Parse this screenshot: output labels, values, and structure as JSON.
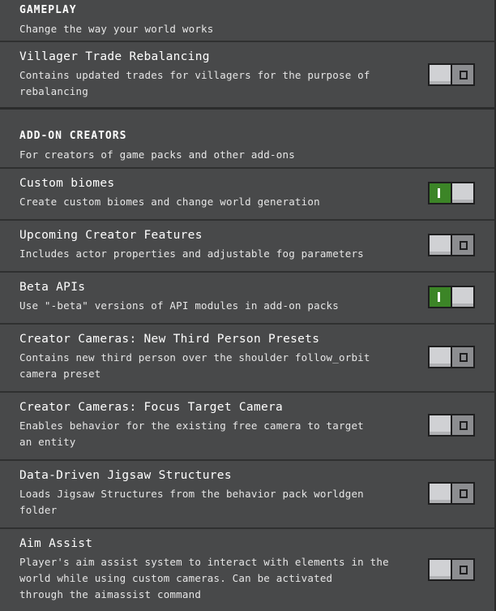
{
  "sections": {
    "gameplay": {
      "title": "GAMEPLAY",
      "description": "Change the way your world works"
    },
    "addon": {
      "title": "ADD-ON CREATORS",
      "description": "For creators of game packs and other add-ons"
    }
  },
  "settings": [
    {
      "title": "Villager Trade Rebalancing",
      "desc_lines": [
        "Contains updated trades for villagers for the purpose of",
        "rebalancing"
      ],
      "enabled": false
    },
    {
      "title": "Custom biomes",
      "desc_lines": [
        "Create custom biomes and change world generation"
      ],
      "enabled": true
    },
    {
      "title": "Upcoming Creator Features",
      "desc_lines": [
        "Includes actor properties and adjustable fog parameters"
      ],
      "enabled": false
    },
    {
      "title": "Beta APIs",
      "desc_lines": [
        "Use \"-beta\" versions of API modules in add-on packs"
      ],
      "enabled": true
    },
    {
      "title": "Creator Cameras: New Third Person Presets",
      "desc_lines": [
        "Contains new third person over the shoulder follow_orbit",
        "camera preset"
      ],
      "enabled": false
    },
    {
      "title": "Creator Cameras: Focus Target Camera",
      "desc_lines": [
        "Enables behavior for the existing free camera to target",
        "an entity"
      ],
      "enabled": false
    },
    {
      "title": "Data-Driven Jigsaw Structures",
      "desc_lines": [
        "Loads Jigsaw Structures from the behavior pack worldgen",
        "folder"
      ],
      "enabled": false
    },
    {
      "title": "Aim Assist",
      "desc_lines": [
        "Player's aim assist system to interact with elements in the",
        "world while using custom cameras. Can be activated",
        "through the aimassist command"
      ],
      "enabled": false
    }
  ],
  "colors": {
    "background": "#48494a",
    "toggle_on": "#3c8527",
    "toggle_off": "#8c8d90"
  }
}
